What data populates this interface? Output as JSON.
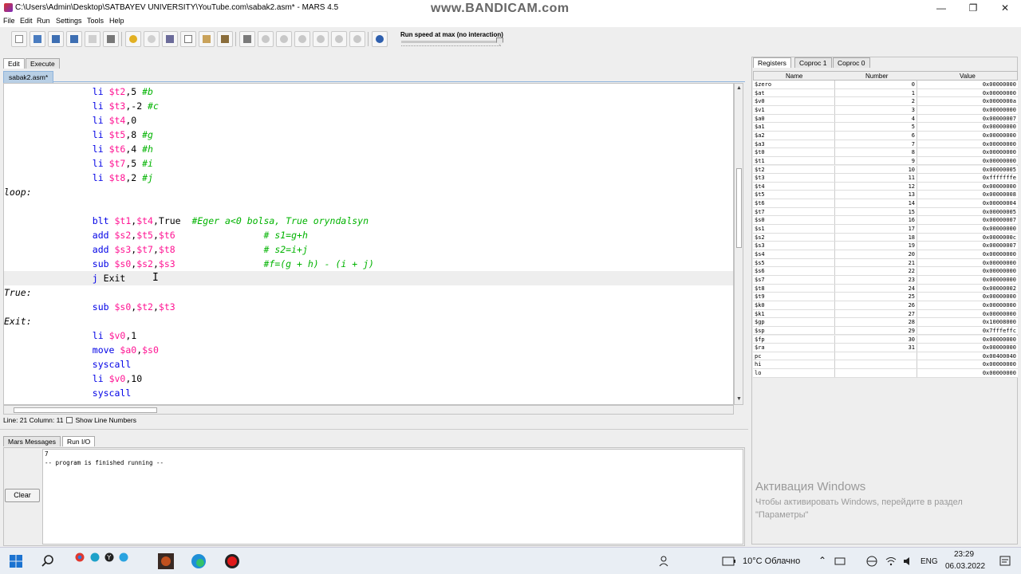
{
  "window": {
    "title": "C:\\Users\\Admin\\Desktop\\SATBAYEV UNIVERSITY\\YouTube.com\\sabak2.asm* - MARS 4.5",
    "watermark": "www.BANDICAM.com",
    "minimize": "—",
    "maximize": "❐",
    "close": "✕"
  },
  "menu": [
    "File",
    "Edit",
    "Run",
    "Settings",
    "Tools",
    "Help"
  ],
  "toolbar": {
    "buttons": [
      "new-file",
      "open-file",
      "save-file",
      "save-as",
      "dump-memory",
      "print",
      "undo",
      "redo",
      "cut",
      "copy",
      "paste",
      "find-replace",
      "assemble",
      "run",
      "step",
      "backstep",
      "pause",
      "stop",
      "reset",
      "help"
    ],
    "speed_label": "Run speed at max (no interaction)",
    "speed_fraction": 1.0
  },
  "left_tabs": [
    "Edit",
    "Execute"
  ],
  "file_tab": "sabak2.asm*",
  "editor": {
    "lines": [
      {
        "parts": [
          [
            "    ",
            ""
          ],
          [
            "li ",
            "kw"
          ],
          [
            "$t2",
            "reg"
          ],
          [
            ",5 ",
            ""
          ],
          [
            "#b",
            "cmt"
          ]
        ]
      },
      {
        "parts": [
          [
            "    ",
            ""
          ],
          [
            "li ",
            "kw"
          ],
          [
            "$t3",
            "reg"
          ],
          [
            ",-2 ",
            ""
          ],
          [
            "#c",
            "cmt"
          ]
        ]
      },
      {
        "parts": [
          [
            "    ",
            ""
          ],
          [
            "li ",
            "kw"
          ],
          [
            "$t4",
            "reg"
          ],
          [
            ",0",
            ""
          ]
        ]
      },
      {
        "parts": [
          [
            "    ",
            ""
          ],
          [
            "li ",
            "kw"
          ],
          [
            "$t5",
            "reg"
          ],
          [
            ",8 ",
            ""
          ],
          [
            "#g",
            "cmt"
          ]
        ]
      },
      {
        "parts": [
          [
            "    ",
            ""
          ],
          [
            "li ",
            "kw"
          ],
          [
            "$t6",
            "reg"
          ],
          [
            ",4 ",
            ""
          ],
          [
            "#h",
            "cmt"
          ]
        ]
      },
      {
        "parts": [
          [
            "    ",
            ""
          ],
          [
            "li ",
            "kw"
          ],
          [
            "$t7",
            "reg"
          ],
          [
            ",5 ",
            ""
          ],
          [
            "#i",
            "cmt"
          ]
        ]
      },
      {
        "parts": [
          [
            "    ",
            ""
          ],
          [
            "li ",
            "kw"
          ],
          [
            "$t8",
            "reg"
          ],
          [
            ",2 ",
            ""
          ],
          [
            "#j",
            "cmt"
          ]
        ]
      },
      {
        "parts": [
          [
            "loop:",
            "lbl"
          ]
        ]
      },
      {
        "parts": []
      },
      {
        "parts": [
          [
            "    ",
            ""
          ],
          [
            "blt ",
            "kw"
          ],
          [
            "$t1",
            "reg"
          ],
          [
            ",",
            ""
          ],
          [
            "$t4",
            "reg"
          ],
          [
            ",True  ",
            ""
          ],
          [
            "#Eger a<0 bolsa, True oryndalsyn",
            "cmt"
          ]
        ]
      },
      {
        "parts": [
          [
            "    ",
            ""
          ],
          [
            "add ",
            "kw"
          ],
          [
            "$s2",
            "reg"
          ],
          [
            ",",
            ""
          ],
          [
            "$t5",
            "reg"
          ],
          [
            ",",
            ""
          ],
          [
            "$t6",
            "reg"
          ],
          [
            "    ",
            ""
          ],
          [
            "# s1=g+h",
            "cmt"
          ]
        ]
      },
      {
        "parts": [
          [
            "    ",
            ""
          ],
          [
            "add ",
            "kw"
          ],
          [
            "$s3",
            "reg"
          ],
          [
            ",",
            ""
          ],
          [
            "$t7",
            "reg"
          ],
          [
            ",",
            ""
          ],
          [
            "$t8",
            "reg"
          ],
          [
            "    ",
            ""
          ],
          [
            "# s2=i+j",
            "cmt"
          ]
        ]
      },
      {
        "parts": [
          [
            "    ",
            ""
          ],
          [
            "sub ",
            "kw"
          ],
          [
            "$s0",
            "reg"
          ],
          [
            ",",
            ""
          ],
          [
            "$s2",
            "reg"
          ],
          [
            ",",
            ""
          ],
          [
            "$s3",
            "reg"
          ],
          [
            "    ",
            ""
          ],
          [
            "#f=(g + h) - (i + j)",
            "cmt"
          ]
        ]
      },
      {
        "parts": [
          [
            "    ",
            ""
          ],
          [
            "j ",
            "kw"
          ],
          [
            "Exit ",
            ""
          ]
        ],
        "current": true
      },
      {
        "parts": [
          [
            "True:",
            "lbl"
          ]
        ]
      },
      {
        "parts": [
          [
            "    ",
            ""
          ],
          [
            "sub ",
            "kw"
          ],
          [
            "$s0",
            "reg"
          ],
          [
            ",",
            ""
          ],
          [
            "$t2",
            "reg"
          ],
          [
            ",",
            ""
          ],
          [
            "$t3",
            "reg"
          ]
        ]
      },
      {
        "parts": [
          [
            "Exit:",
            "lbl"
          ]
        ]
      },
      {
        "parts": [
          [
            "    ",
            ""
          ],
          [
            "li ",
            "kw"
          ],
          [
            "$v0",
            "reg"
          ],
          [
            ",1",
            ""
          ]
        ]
      },
      {
        "parts": [
          [
            "    ",
            ""
          ],
          [
            "move ",
            "kw"
          ],
          [
            "$a0",
            "reg"
          ],
          [
            ",",
            ""
          ],
          [
            "$s0",
            "reg"
          ]
        ]
      },
      {
        "parts": [
          [
            "    ",
            ""
          ],
          [
            "syscall",
            "kw"
          ]
        ]
      },
      {
        "parts": [
          [
            "    ",
            ""
          ],
          [
            "li ",
            "kw"
          ],
          [
            "$v0",
            "reg"
          ],
          [
            ",10",
            ""
          ]
        ]
      },
      {
        "parts": [
          [
            "    ",
            ""
          ],
          [
            "syscall",
            "kw"
          ]
        ]
      }
    ]
  },
  "status": {
    "position": "Line: 21 Column: 11",
    "show_line_numbers": "Show Line Numbers"
  },
  "bottom_tabs": [
    "Mars Messages",
    "Run I/O"
  ],
  "clear_label": "Clear",
  "output_lines": [
    "7",
    "-- program is finished running --"
  ],
  "register_tabs": [
    "Registers",
    "Coproc 1",
    "Coproc 0"
  ],
  "register_headers": [
    "Name",
    "Number",
    "Value"
  ],
  "registers": [
    [
      "$zero",
      "0",
      "0x00000000"
    ],
    [
      "$at",
      "1",
      "0x00000000"
    ],
    [
      "$v0",
      "2",
      "0x0000000a"
    ],
    [
      "$v1",
      "3",
      "0x00000000"
    ],
    [
      "$a0",
      "4",
      "0x00000007"
    ],
    [
      "$a1",
      "5",
      "0x00000000"
    ],
    [
      "$a2",
      "6",
      "0x00000000"
    ],
    [
      "$a3",
      "7",
      "0x00000000"
    ],
    [
      "$t0",
      "8",
      "0x00000000"
    ],
    [
      "$t1",
      "9",
      "0x00000000"
    ],
    [
      "$t2",
      "10",
      "0x00000005"
    ],
    [
      "$t3",
      "11",
      "0xfffffffe"
    ],
    [
      "$t4",
      "12",
      "0x00000000"
    ],
    [
      "$t5",
      "13",
      "0x00000008"
    ],
    [
      "$t6",
      "14",
      "0x00000004"
    ],
    [
      "$t7",
      "15",
      "0x00000005"
    ],
    [
      "$s0",
      "16",
      "0x00000007"
    ],
    [
      "$s1",
      "17",
      "0x00000000"
    ],
    [
      "$s2",
      "18",
      "0x0000000c"
    ],
    [
      "$s3",
      "19",
      "0x00000007"
    ],
    [
      "$s4",
      "20",
      "0x00000000"
    ],
    [
      "$s5",
      "21",
      "0x00000000"
    ],
    [
      "$s6",
      "22",
      "0x00000000"
    ],
    [
      "$s7",
      "23",
      "0x00000000"
    ],
    [
      "$t8",
      "24",
      "0x00000002"
    ],
    [
      "$t9",
      "25",
      "0x00000000"
    ],
    [
      "$k0",
      "26",
      "0x00000000"
    ],
    [
      "$k1",
      "27",
      "0x00000000"
    ],
    [
      "$gp",
      "28",
      "0x10008000"
    ],
    [
      "$sp",
      "29",
      "0x7fffeffc"
    ],
    [
      "$fp",
      "30",
      "0x00000000"
    ],
    [
      "$ra",
      "31",
      "0x00000000"
    ],
    [
      "pc",
      "",
      "0x00400040"
    ],
    [
      "hi",
      "",
      "0x00000000"
    ],
    [
      "lo",
      "",
      "0x00000000"
    ]
  ],
  "activation": {
    "heading": "Активация Windows",
    "line1": "Чтобы активировать Windows, перейдите в раздел",
    "line2": "\"Параметры\""
  },
  "taskbar": {
    "weather": "10°C Облачно",
    "language": "ENG",
    "time": "23:29",
    "date": "06.03.2022"
  }
}
